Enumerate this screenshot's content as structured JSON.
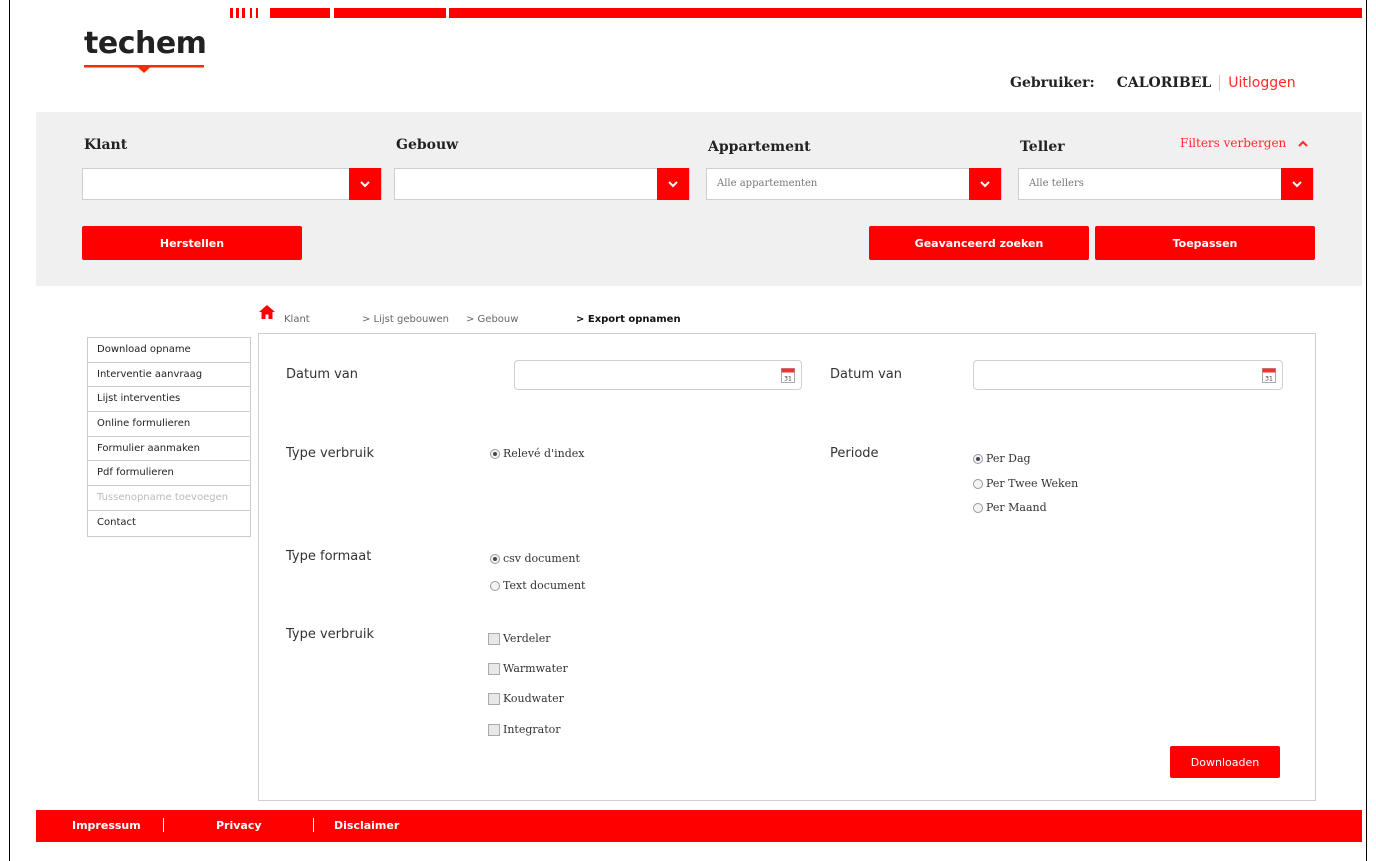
{
  "header": {
    "logo_text": "techem",
    "user_label": "Gebruiker:",
    "user_name": "CALORIBEL",
    "logout_label": "Uitloggen"
  },
  "filters": {
    "klant_label": "Klant",
    "gebouw_label": "Gebouw",
    "appartement_label": "Appartement",
    "teller_label": "Teller",
    "toggle_label": "Filters verbergen",
    "klant_value": "",
    "gebouw_value": "",
    "appartement_value": "Alle appartementen",
    "teller_value": "Alle tellers",
    "reset_label": "Herstellen",
    "advanced_label": "Geavanceerd zoeken",
    "apply_label": "Toepassen"
  },
  "breadcrumb": {
    "home": "Klant",
    "buildings": "> Lijst gebouwen",
    "building": "> Gebouw",
    "current": "> Export opnamen"
  },
  "sidebar": {
    "items": [
      {
        "label": "Download opname"
      },
      {
        "label": "Interventie aanvraag"
      },
      {
        "label": "Lijst interventies"
      },
      {
        "label": "Online formulieren"
      },
      {
        "label": "Formulier aanmaken"
      },
      {
        "label": "Pdf formulieren"
      },
      {
        "label": "Tussenopname toevoegen"
      },
      {
        "label": "Contact"
      }
    ]
  },
  "form": {
    "date_from_label": "Datum van",
    "date_to_label": "Datum van",
    "date_from_value": "",
    "date_to_value": "",
    "calendar_day": "31",
    "type_usage_label": "Type verbruik",
    "type_usage_option": "Relevé d'index",
    "period_label": "Periode",
    "period_options": [
      "Per Dag",
      "Per Twee Weken",
      "Per Maand"
    ],
    "period_selected": "Per Dag",
    "format_label": "Type formaat",
    "format_options": [
      "csv document",
      "Text document"
    ],
    "format_selected": "csv document",
    "type_usage2_label": "Type verbruik",
    "meter_types": [
      "Verdeler",
      "Warmwater",
      "Koudwater",
      "Integrator"
    ],
    "download_label": "Downloaden"
  },
  "footer": {
    "links": [
      "Impressum",
      "Privacy",
      "Disclaimer"
    ]
  },
  "colors": {
    "accent": "#ff0000",
    "panel": "#f0f0f0"
  }
}
